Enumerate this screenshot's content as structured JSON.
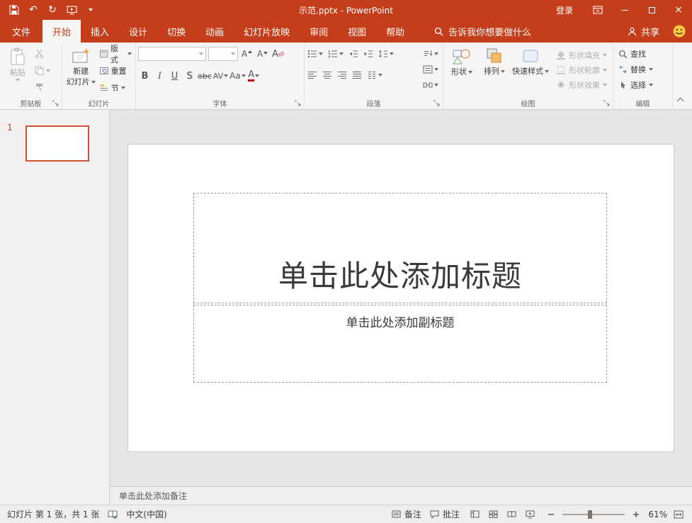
{
  "colors": {
    "accent": "#C43E1C",
    "font_color_swatch": "#C00000",
    "thumb_border": "#D05333"
  },
  "titlebar": {
    "title": "示范.pptx - PowerPoint",
    "signin": "登录"
  },
  "tabs": {
    "file": "文件",
    "list": [
      "开始",
      "插入",
      "设计",
      "切换",
      "动画",
      "幻灯片放映",
      "审阅",
      "视图",
      "帮助"
    ],
    "active": "开始",
    "tellme": "告诉我你想要做什么",
    "share": "共享"
  },
  "ribbon": {
    "clipboard": {
      "label": "剪贴板",
      "paste": "粘贴"
    },
    "slides": {
      "label": "幻灯片",
      "new_slide_line1": "新建",
      "new_slide_line2": "幻灯片",
      "layout": "版式",
      "reset": "重置",
      "section": "节"
    },
    "font": {
      "label": "字体",
      "bold": "B",
      "italic": "I",
      "underline": "U",
      "shadow": "S",
      "strikethrough": "abc",
      "char_spacing": "AV",
      "change_case": "Aa",
      "font_color": "A",
      "grow_font": "A",
      "shrink_font": "A",
      "clear_format": "A"
    },
    "paragraph": {
      "label": "段落"
    },
    "drawing": {
      "label": "绘图",
      "shapes": "形状",
      "arrange": "排列",
      "quick_styles": "快速样式",
      "shape_fill": "形状填充",
      "shape_outline": "形状轮廓",
      "shape_effects": "形状效果"
    },
    "editing": {
      "label": "编辑",
      "find": "查找",
      "replace": "替换",
      "select": "选择"
    }
  },
  "thumbnail_panel": {
    "slide_number": "1"
  },
  "slide": {
    "title_placeholder": "单击此处添加标题",
    "subtitle_placeholder": "单击此处添加副标题"
  },
  "notes": {
    "placeholder": "单击此处添加备注"
  },
  "statusbar": {
    "slide_info": "幻灯片 第 1 张，共 1 张",
    "language": "中文(中国)",
    "notes_toggle": "备注",
    "comments_toggle": "批注",
    "zoom_level": "61%"
  }
}
